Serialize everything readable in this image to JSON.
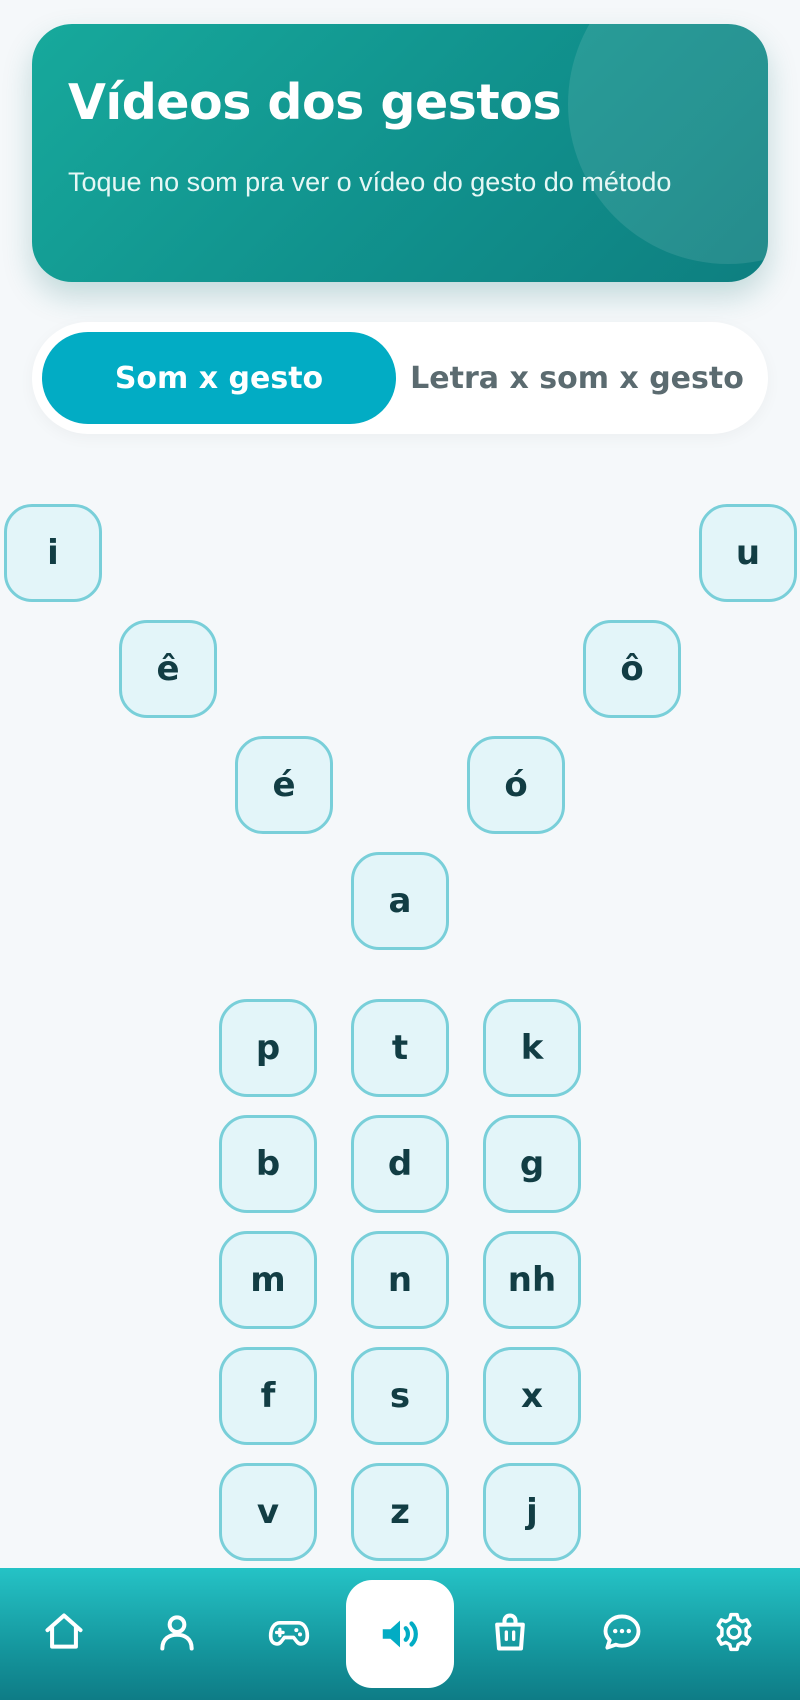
{
  "header": {
    "title": "Vídeos dos gestos",
    "subtitle": "Toque no som pra ver o vídeo do gesto do método"
  },
  "tabs": [
    {
      "label": "Som x gesto",
      "active": true
    },
    {
      "label": "Letra x som x gesto",
      "active": false
    }
  ],
  "vowels": [
    "i",
    "u",
    "ê",
    "ô",
    "é",
    "ó",
    "a"
  ],
  "consonants": [
    [
      "p",
      "t",
      "k"
    ],
    [
      "b",
      "d",
      "g"
    ],
    [
      "m",
      "n",
      "nh"
    ],
    [
      "f",
      "s",
      "x"
    ],
    [
      "v",
      "z",
      "j"
    ]
  ],
  "nav": {
    "items": [
      "home-icon",
      "profile-icon",
      "gamepad-icon",
      "sound-icon",
      "shopping-bag-icon",
      "chat-icon",
      "settings-icon"
    ],
    "active": "sound-icon"
  },
  "colors": {
    "accent": "#02acc4",
    "hero": "#11938e",
    "key_border": "#79cfd9",
    "key_bg": "#e3f5f9"
  }
}
